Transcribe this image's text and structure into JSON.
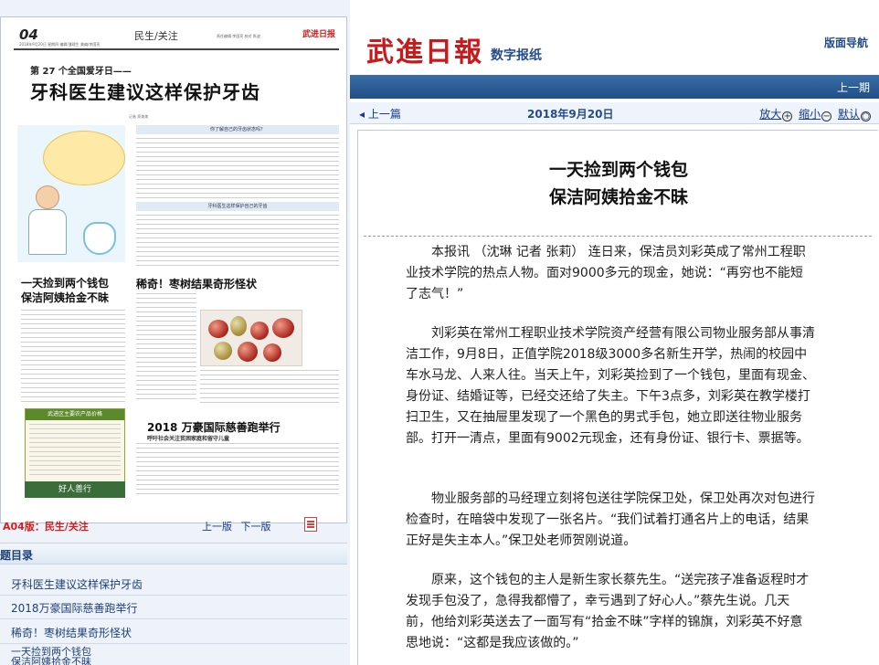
{
  "left": {
    "page": {
      "page_number": "04",
      "date_line": "2018年9月20日 星期四 编辑/潘理生 美编/李国亮",
      "section": "民生/关注",
      "mini_header": "责任编辑 李国亮 校对 陈波",
      "logo": "武进日报",
      "kicker": "第 27 个全国爱牙日——",
      "headline": "牙科医生建议这样保护牙齿",
      "byline": "记者 郑美美",
      "box_heading_1": "你了解自己的牙齿状态吗？",
      "box_heading_2": "牙科医生这样保护自己的牙齿",
      "story_1_line1": "一天捡到两个钱包",
      "story_1_line2": "保洁阿姨拾金不昧",
      "story_2": "稀奇！枣树结果奇形怪状",
      "story_3": "2018 万豪国际慈善跑举行",
      "story_3_sub": "呼吁社会关注贫困家庭和留守儿童",
      "price_box_title": "武进区主要农产品价格",
      "good_people": "好人善行"
    },
    "footer": {
      "section_label": "A04版：民生/关注",
      "prev_page": "上一版",
      "next_page": "下一版"
    },
    "toc": {
      "title": "题目录",
      "items": [
        "牙科医生建议这样保护牙齿",
        "2018万豪国际慈善跑举行",
        "稀奇！枣树结果奇形怪状",
        "一天捡到两个钱包",
        "保洁阿姨拾金不昧"
      ]
    }
  },
  "right": {
    "logo": "武進日報",
    "subtitle": "数字报纸",
    "layout_nav": "版面导航",
    "prev_issue": "上一期",
    "prev_page": "上一篇",
    "date": "2018年9月20日",
    "zoom_in": "放大",
    "zoom_out": "缩小",
    "default": "默认",
    "zoom_in_glyph": "+",
    "zoom_out_glyph": "−",
    "default_glyph": "○"
  },
  "article": {
    "title_line1": "一天捡到两个钱包",
    "title_line2": "保洁阿姨拾金不昧",
    "paragraphs": [
      "本报讯 （沈琳 记者 张莉） 连日来，保洁员刘彩英成了常州工程职业技术学院的热点人物。面对9000多元的现金，她说：“再穷也不能短了志气！”",
      "刘彩英在常州工程职业技术学院资产经营有限公司物业服务部从事清洁工作，9月8日，正值学院2018级3000多名新生开学，热闹的校园中车水马龙、人来人往。当天上午，刘彩英捡到了一个钱包，里面有现金、身份证、结婚证等，已经交还给了失主。下午3点多，刘彩英在教学楼打扫卫生，又在抽屉里发现了一个黑色的男式手包，她立即送往物业服务部。打开一清点，里面有9002元现金，还有身份证、银行卡、票据等。",
      "物业服务部的马经理立刻将包送往学院保卫处，保卫处再次对包进行检查时，在暗袋中发现了一张名片。“我们试着打通名片上的电话，结果正好是失主本人。”保卫处老师贺刚说道。",
      "原来，这个钱包的主人是新生家长蔡先生。“送完孩子准备返程时才发现手包没了，急得我都懵了，幸亏遇到了好心人。”蔡先生说。几天前，他给刘彩英送去了一面写有“拾金不昧”字样的锦旗，刘彩英不好意思地说：“这都是我应该做的。”"
    ]
  }
}
